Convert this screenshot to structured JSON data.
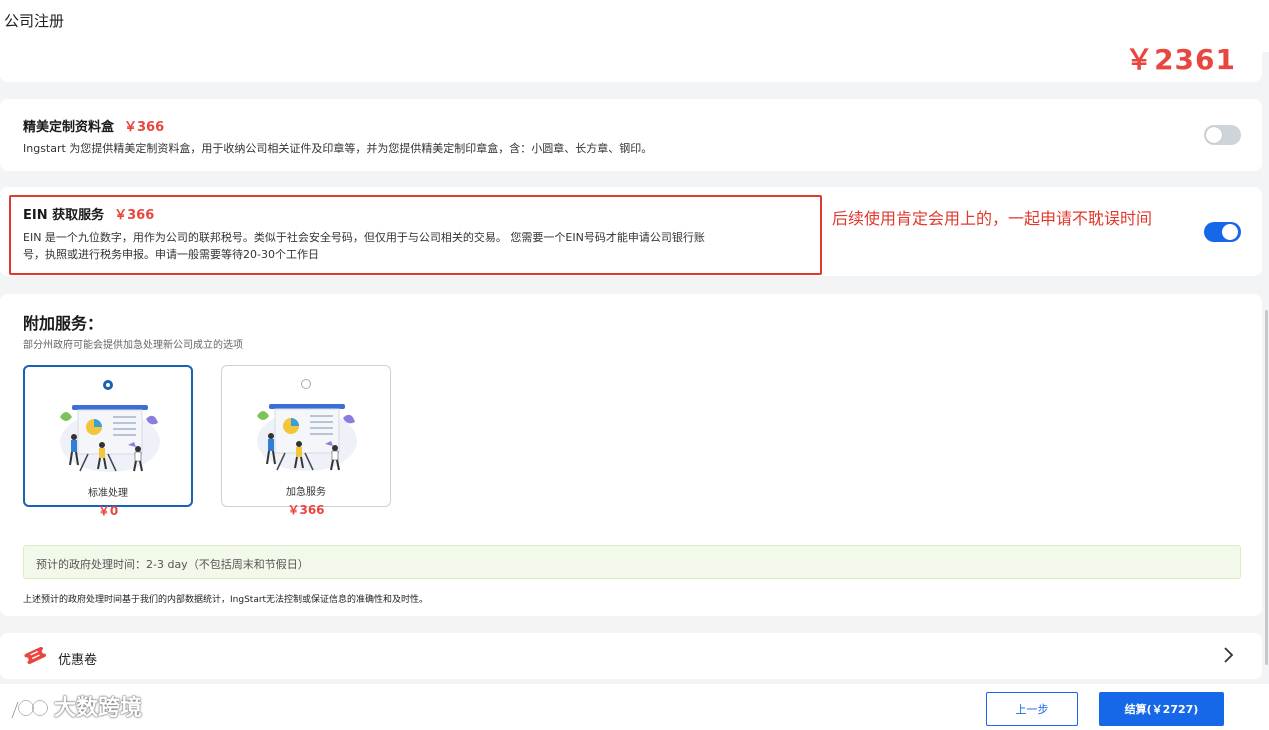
{
  "page": {
    "title": "公司注册"
  },
  "summary": {
    "price": "￥2361"
  },
  "services": [
    {
      "title": "精美定制资料盒",
      "price": "￥366",
      "desc": "Ingstart 为您提供精美定制资料盒，用于收纳公司相关证件及印章等，并为您提供精美定制印章盒，含：小圆章、长方章、钢印。",
      "enabled": false
    },
    {
      "title": "EIN 获取服务",
      "price": "￥366",
      "desc_line1": "EIN 是一个九位数字，用作为公司的联邦税号。类似于社会安全号码，但仅用于与公司相关的交易。 您需要一个EIN号码才能申请公司银行账",
      "desc_line2": "号，执照或进行税务申报。申请一般需要等待20-30个工作日",
      "enabled": true
    }
  ],
  "annotation": "后续使用肯定会用上的，一起申请不耽误时间",
  "extra": {
    "title": "附加服务：",
    "subtitle": "部分州政府可能会提供加急处理新公司成立的选项",
    "options": [
      {
        "label": "标准处理",
        "price": "￥0",
        "selected": true
      },
      {
        "label": "加急服务",
        "price": "￥366",
        "selected": false
      }
    ],
    "eta": "预计的政府处理时间：2-3 day（不包括周末和节假日）",
    "disclaimer": "上述预计的政府处理时间基于我们的内部数据统计，IngStart无法控制或保证信息的准确性和及时性。"
  },
  "coupon": {
    "label": "优惠卷"
  },
  "footer": {
    "prev_label": "上一步",
    "pay_label": "结算(￥2727)",
    "watermark": "大数跨境"
  },
  "colors": {
    "accent": "#1668e8",
    "price": "#e8463e",
    "annotation": "#e03a2e"
  }
}
